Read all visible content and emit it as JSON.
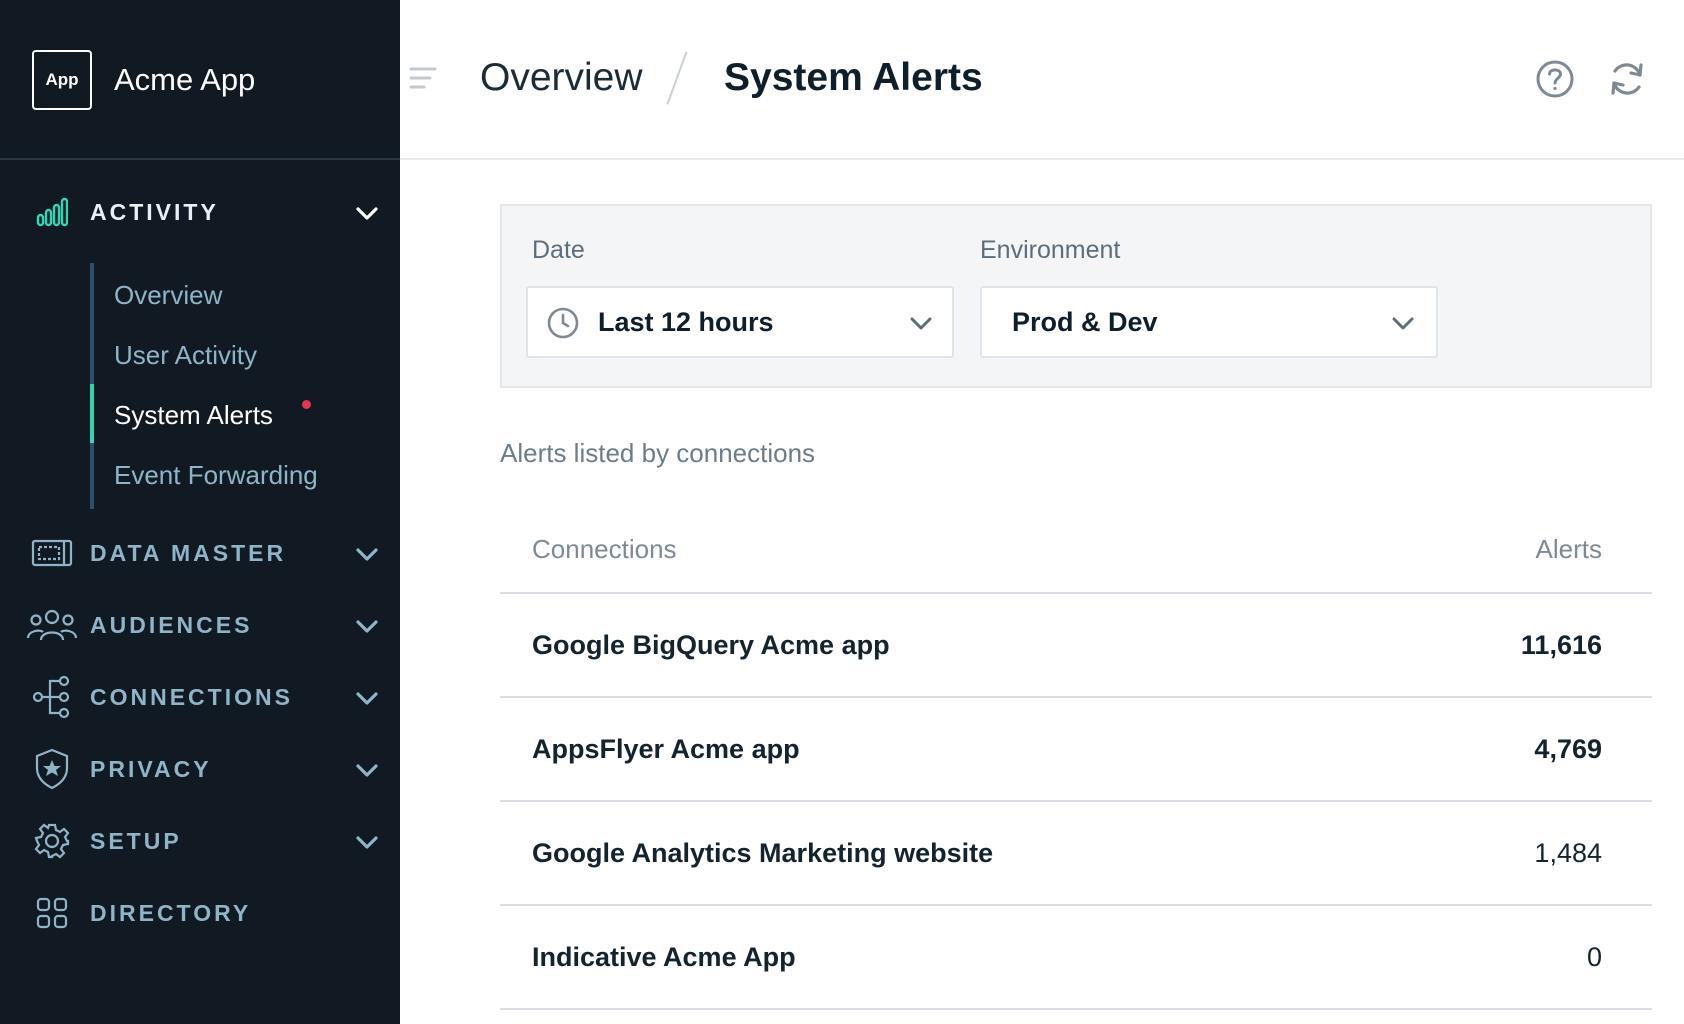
{
  "brand": {
    "logo_text": "App",
    "name": "Acme App"
  },
  "sidebar": {
    "sections": [
      {
        "label": "ACTIVITY",
        "icon": "bar-chart-icon",
        "expanded": true
      },
      {
        "label": "DATA MASTER",
        "icon": "data-master-icon"
      },
      {
        "label": "AUDIENCES",
        "icon": "audiences-icon"
      },
      {
        "label": "CONNECTIONS",
        "icon": "connections-icon"
      },
      {
        "label": "PRIVACY",
        "icon": "privacy-shield-icon"
      },
      {
        "label": "SETUP",
        "icon": "gear-icon"
      },
      {
        "label": "DIRECTORY",
        "icon": "directory-grid-icon"
      }
    ],
    "activity_items": [
      {
        "label": "Overview"
      },
      {
        "label": "User Activity"
      },
      {
        "label": "System Alerts",
        "active": true,
        "has_alert": true
      },
      {
        "label": "Event Forwarding"
      }
    ]
  },
  "header": {
    "breadcrumb_parent": "Overview",
    "breadcrumb_current": "System Alerts",
    "icons": [
      "menu-toggle-icon",
      "help-icon",
      "refresh-icon"
    ]
  },
  "filters": {
    "date": {
      "label": "Date",
      "value": "Last 12 hours",
      "icon": "clock-icon"
    },
    "environment": {
      "label": "Environment",
      "value": "Prod & Dev"
    }
  },
  "alerts_table": {
    "caption": "Alerts listed by connections",
    "headers": {
      "connections": "Connections",
      "alerts": "Alerts"
    },
    "rows": [
      {
        "connection": "Google BigQuery Acme app",
        "alerts": "11,616",
        "emphasis": true
      },
      {
        "connection": "AppsFlyer Acme app",
        "alerts": "4,769",
        "emphasis": true
      },
      {
        "connection": "Google Analytics Marketing website",
        "alerts": "1,484",
        "emphasis": false
      },
      {
        "connection": "Indicative Acme App",
        "alerts": "0",
        "emphasis": false
      }
    ]
  },
  "colors": {
    "sidebar_bg": "#111a23",
    "nav_text": "#8fb4c8",
    "accent_teal": "#2fd7b4",
    "alert_red": "#e8344f"
  }
}
